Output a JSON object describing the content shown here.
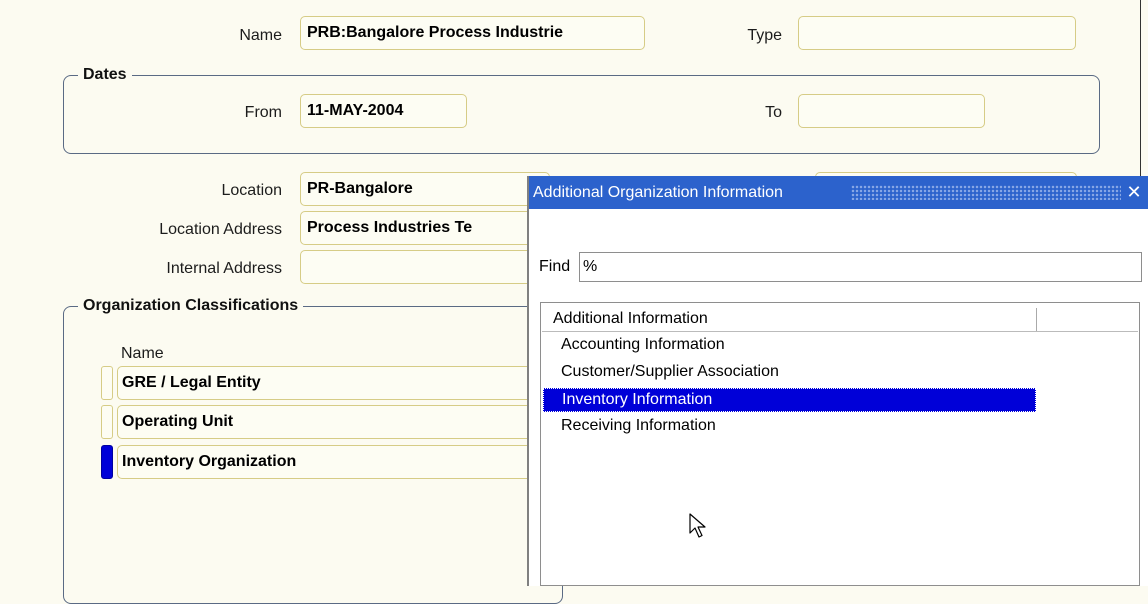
{
  "form": {
    "name_label": "Name",
    "name_value": "PRB:Bangalore Process Industrie",
    "type_label": "Type",
    "type_value": "",
    "dates_legend": "Dates",
    "from_label": "From",
    "from_value": "11-MAY-2004",
    "to_label": "To",
    "to_value": "",
    "location_label": "Location",
    "location_value": "PR-Bangalore",
    "location_address_label": "Location Address",
    "location_address_value": "Process Industries Te",
    "internal_address_label": "Internal Address",
    "internal_address_value": ""
  },
  "classifications": {
    "legend": "Organization Classifications",
    "name_header": "Name",
    "rows": [
      "GRE / Legal Entity",
      "Operating Unit",
      "Inventory Organization"
    ],
    "selected_index": 2
  },
  "dialog": {
    "title": "Additional Organization Information",
    "close_glyph": "✕",
    "find_label": "Find",
    "find_value": "%",
    "list_header": "Additional Information",
    "items": [
      "Accounting Information",
      "Customer/Supplier Association",
      "Inventory Information",
      "Receiving Information"
    ],
    "selected_index": 2
  },
  "colors": {
    "background": "#fcfbf1",
    "field_border": "#d6cc86",
    "titlebar": "#2c62cc",
    "selection": "#0000d8",
    "group_border": "#5a6a84"
  },
  "icons": {
    "cursor": "arrow-pointer-icon",
    "close": "close-icon"
  }
}
